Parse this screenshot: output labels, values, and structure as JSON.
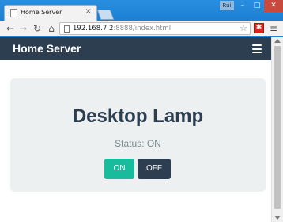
{
  "browser": {
    "tab_title": "Home Server",
    "tab_close": "×",
    "user_badge": "Rui",
    "window_controls": {
      "minimize": "–",
      "maximize": "□",
      "close": "✕"
    },
    "url_host": "192.168.7.2",
    "url_rest": ":8888/index.html",
    "nav": {
      "back": "←",
      "forward": "→",
      "reload": "↻",
      "home": "⌂"
    },
    "star": "☆",
    "extension_icon": "✱",
    "menu_icon": "≡"
  },
  "app": {
    "brand": "Home Server",
    "device": {
      "name": "Desktop Lamp",
      "status_text": "Status: ON",
      "on_label": "ON",
      "off_label": "OFF"
    }
  },
  "colors": {
    "navbar": "#2c3e50",
    "on_button": "#18bc9c",
    "off_button": "#2c3e50",
    "panel": "#ecf0f1"
  }
}
